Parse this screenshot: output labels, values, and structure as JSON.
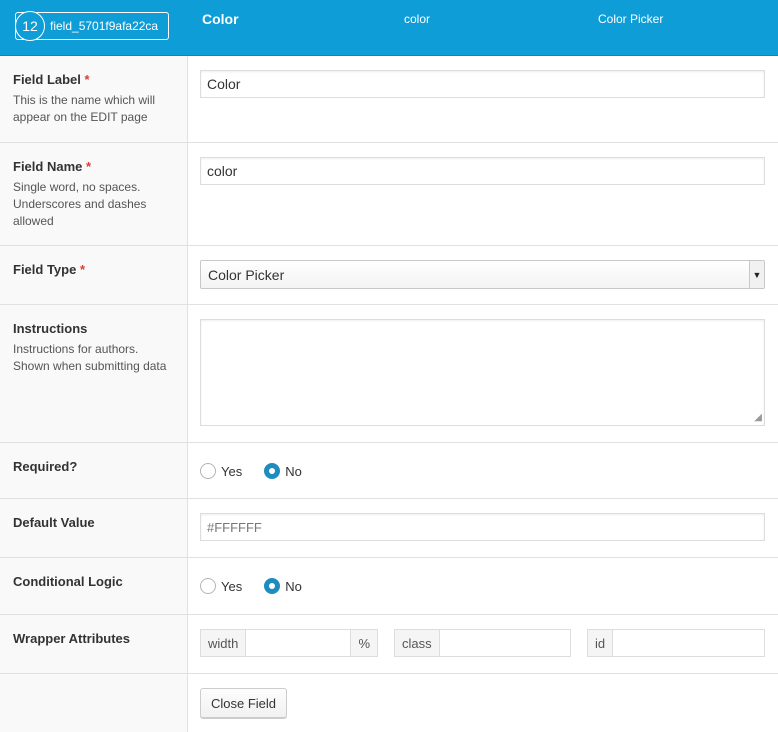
{
  "header": {
    "order": "12",
    "field_key": "field_5701f9afa22ca",
    "label": "Color",
    "name": "color",
    "type": "Color Picker",
    "bg_color": "#0e9dd6"
  },
  "fields": {
    "field_label": {
      "title": "Field Label",
      "required_mark": "*",
      "description": "This is the name which will appear on the EDIT page",
      "value": "Color"
    },
    "field_name": {
      "title": "Field Name",
      "required_mark": "*",
      "description": "Single word, no spaces. Underscores and dashes allowed",
      "value": "color"
    },
    "field_type": {
      "title": "Field Type",
      "required_mark": "*",
      "selected": "Color Picker"
    },
    "instructions": {
      "title": "Instructions",
      "description": "Instructions for authors. Shown when submitting data",
      "value": ""
    },
    "required": {
      "title": "Required?",
      "options": [
        "Yes",
        "No"
      ],
      "selected": "No"
    },
    "default_value": {
      "title": "Default Value",
      "placeholder": "#FFFFFF"
    },
    "conditional_logic": {
      "title": "Conditional Logic",
      "options": [
        "Yes",
        "No"
      ],
      "selected": "No"
    },
    "wrapper": {
      "title": "Wrapper Attributes",
      "width_label": "width",
      "width_unit": "%",
      "class_label": "class",
      "id_label": "id"
    }
  },
  "actions": {
    "close_label": "Close Field"
  },
  "colors": {
    "required": "#dd3d36",
    "radio_checked": "#1e8cbe"
  }
}
